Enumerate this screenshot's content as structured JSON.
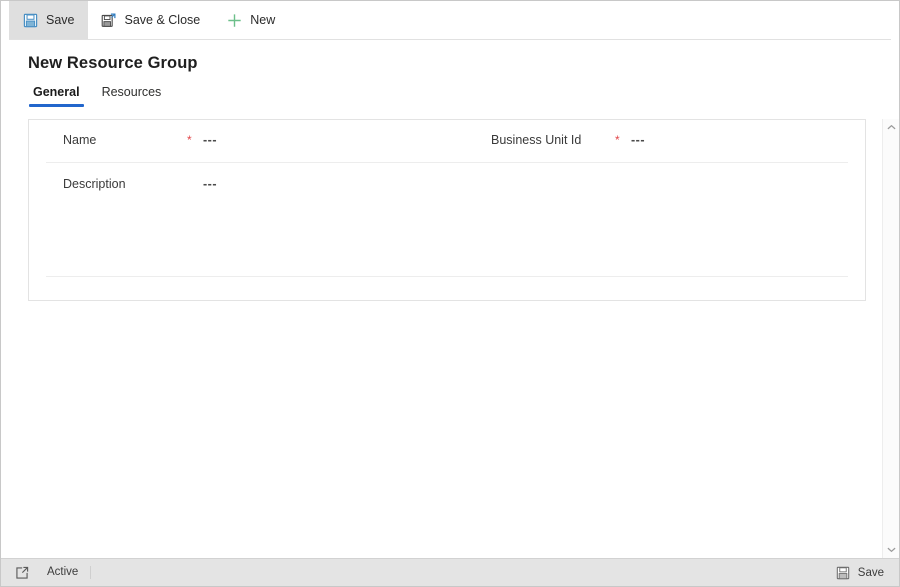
{
  "toolbar": {
    "buttons": [
      {
        "label": "Save",
        "icon": "save-floppy-icon",
        "active": true
      },
      {
        "label": "Save & Close",
        "icon": "save-and-close-floppy-icon",
        "active": false
      },
      {
        "label": "New",
        "icon": "plus-icon",
        "active": false
      }
    ]
  },
  "header": {
    "title": "New Resource Group"
  },
  "tabs": [
    {
      "label": "General",
      "selected": true
    },
    {
      "label": "Resources",
      "selected": false
    }
  ],
  "form": {
    "fields": {
      "name": {
        "label": "Name",
        "required_marker": "*",
        "value": "---"
      },
      "business_unit_id": {
        "label": "Business Unit Id",
        "required_marker": "*",
        "value": "---"
      },
      "description": {
        "label": "Description",
        "value": "---"
      }
    }
  },
  "statusbar": {
    "popout_icon": "open-in-new-window-icon",
    "state": "Active",
    "save_label": "Save",
    "save_icon": "save-floppy-icon"
  },
  "colors": {
    "accent_tab_underline": "#2266cc",
    "required_asterisk": "#e2464a",
    "new_icon_green": "#6cbf8a",
    "save_icon_blue": "#4a90c4",
    "statusbar_background": "#e4e4e4",
    "card_border": "#e3e3e3"
  },
  "scrollbar": {
    "up_arrow": "chevron-up-icon",
    "down_arrow": "chevron-down-icon"
  }
}
